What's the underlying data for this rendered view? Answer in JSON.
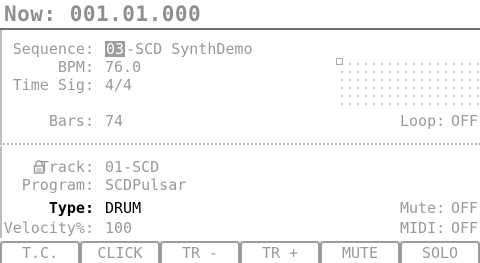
{
  "header": {
    "title": "Now: 001.01.000"
  },
  "sequence": {
    "label": "Sequence:",
    "number": "03",
    "name": "-SCD SynthDemo",
    "bpm_label": "BPM:",
    "bpm": "76.0",
    "timesig_label": "Time Sig:",
    "timesig": "4/4",
    "bars_label": "Bars:",
    "bars": "74",
    "loop_label": "Loop:",
    "loop": "OFF"
  },
  "track": {
    "label": "Track:",
    "value": "01-SCD",
    "program_label": "Program:",
    "program": "SCDPulsar",
    "type_label": "Type:",
    "type": "DRUM",
    "velocity_label": "Velocity%:",
    "velocity": "100",
    "mute_label": "Mute:",
    "mute": "OFF",
    "midi_label": "MIDI:",
    "midi": "OFF"
  },
  "softkeys": [
    "T.C.",
    "CLICK",
    "TR -",
    "TR +",
    "MUTE",
    "SOLO"
  ],
  "icons": {
    "lock": "lock-icon",
    "grid": "grid-dots"
  }
}
